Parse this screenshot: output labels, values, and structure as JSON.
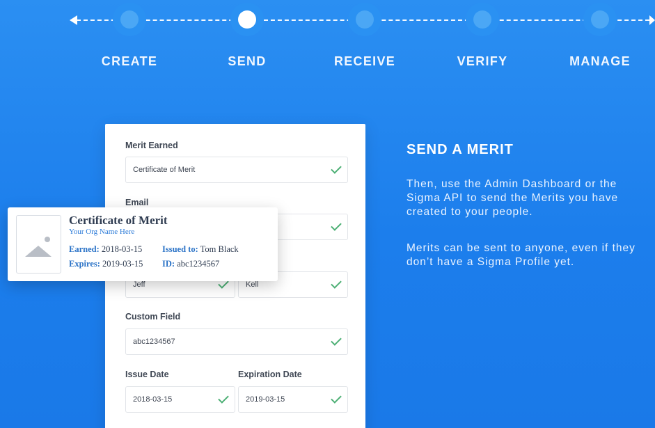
{
  "steps": {
    "items": [
      {
        "label": "CREATE",
        "active": false
      },
      {
        "label": "SEND",
        "active": true
      },
      {
        "label": "RECEIVE",
        "active": false
      },
      {
        "label": "VERIFY",
        "active": false
      },
      {
        "label": "MANAGE",
        "active": false
      }
    ]
  },
  "form": {
    "merit_earned": {
      "label": "Merit Earned",
      "value": "Certificate of Merit"
    },
    "email": {
      "label": "Email",
      "value": ""
    },
    "first_name": {
      "value": "Jeff"
    },
    "last_name": {
      "value": "Kell"
    },
    "custom_field": {
      "label": "Custom Field",
      "value": "abc1234567"
    },
    "issue_date": {
      "label": "Issue Date",
      "value": "2018-03-15"
    },
    "expiration_date": {
      "label": "Expiration Date",
      "value": "2019-03-15"
    }
  },
  "certificate": {
    "title": "Certificate of Merit",
    "org": "Your Org Name Here",
    "earned_label": "Earned:",
    "earned_value": "2018-03-15",
    "expires_label": "Expires:",
    "expires_value": "2019-03-15",
    "issued_to_label": "Issued to:",
    "issued_to_value": "Tom Black",
    "id_label": "ID:",
    "id_value": "abc1234567"
  },
  "copy": {
    "title": "SEND A MERIT",
    "paragraph1": "Then, use the Admin Dashboard or the Sigma API to send the Merits you have created to your people.",
    "paragraph2": "Merits can be sent to anyone, even if they don’t have a Sigma Profile yet."
  },
  "colors": {
    "background": "#1c7eec",
    "success_check": "#4caf74",
    "link_blue": "#2b73c7"
  }
}
